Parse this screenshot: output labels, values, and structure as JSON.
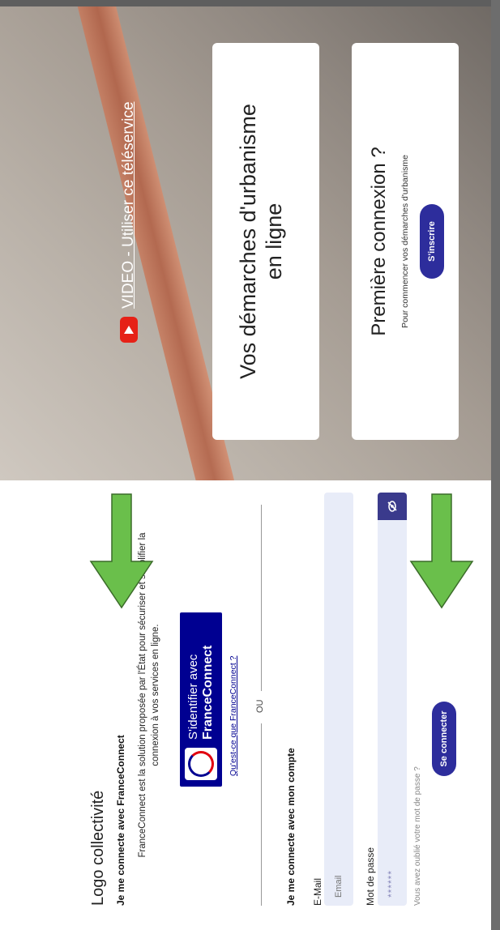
{
  "login": {
    "logo_text": "Logo collectivité",
    "franceconnect_heading": "Je me connecte avec FranceConnect",
    "franceconnect_description": "FranceConnect est la solution proposée par l'État pour sécuriser et simplifier la connexion à vos services en ligne.",
    "franceconnect_button_line1": "S'identifier avec",
    "franceconnect_button_line2": "FranceConnect",
    "franceconnect_link": "Qu'est-ce que FranceConnect ?",
    "separator": "OU",
    "account_heading": "Je me connecte avec mon compte",
    "email_label": "E-Mail",
    "email_placeholder": "Email",
    "password_label": "Mot de passe",
    "password_value": "******",
    "forgot_link": "Vous avez oublié votre mot de passe ?",
    "connect_button": "Se connecter"
  },
  "hero": {
    "video_link": "VIDEO - Utiliser ce téléservice",
    "card_title_line1": "Vos démarches d'urbanisme",
    "card_title_line2": "en ligne",
    "first_connection_title": "Première connexion ?",
    "first_connection_subtitle": "Pour commencer vos démarches d'urbanisme",
    "signup_button": "S'inscrire"
  },
  "colors": {
    "primary": "#2d2d9c",
    "franceconnect_blue": "#000091",
    "arrow_green": "#6abf4b",
    "youtube_red": "#e62117",
    "input_bg": "#e8ecf8"
  }
}
